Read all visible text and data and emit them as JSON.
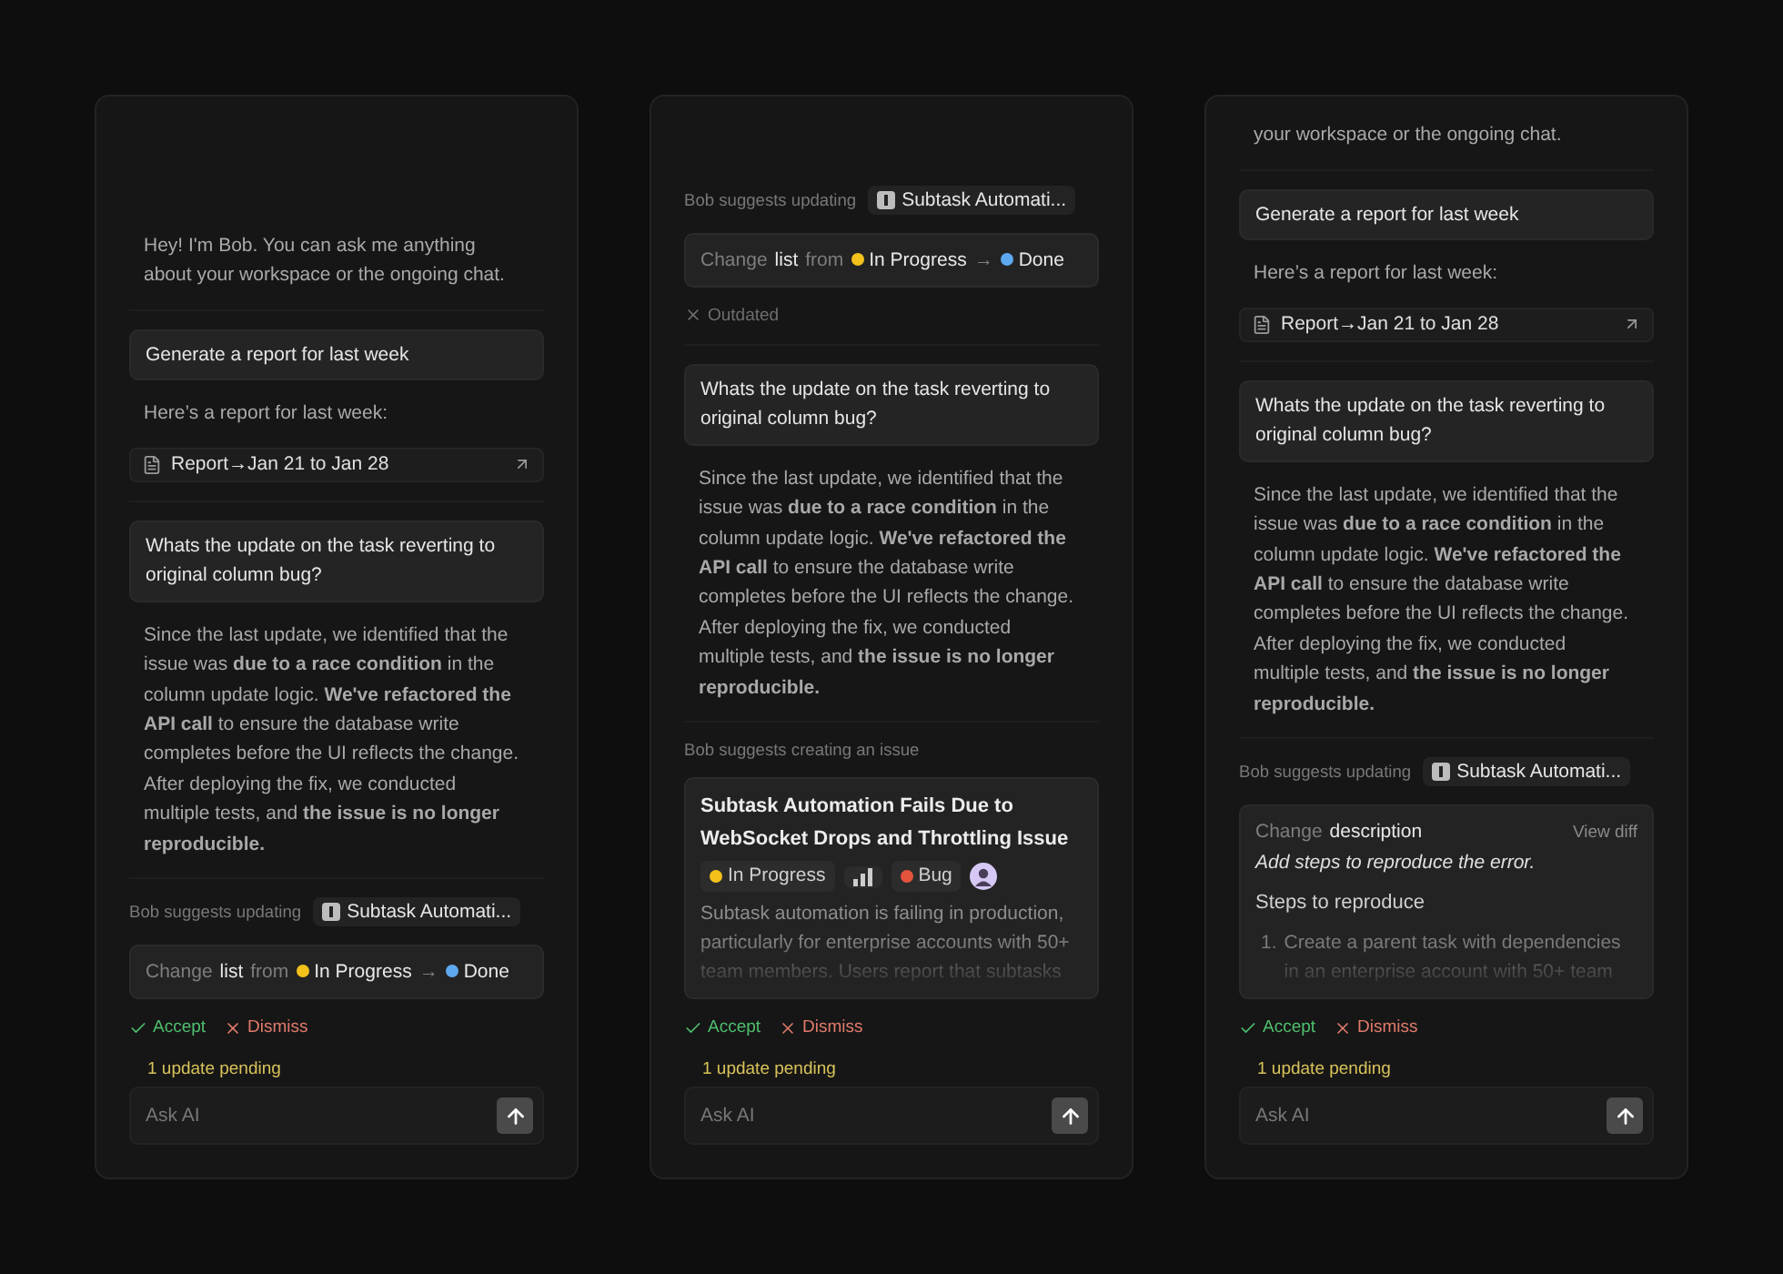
{
  "panels": [
    {
      "messages": [
        {
          "kind": "bot_text",
          "text": "Hey! I'm Bob. You can ask me anything about your workspace or the ongoing chat."
        },
        {
          "kind": "divider"
        },
        {
          "kind": "user",
          "text": "Generate a report for last week"
        },
        {
          "kind": "bot_text",
          "text": "Here’s a report for last week:"
        },
        {
          "kind": "report",
          "text": "Report→Jan 21 to Jan 28"
        },
        {
          "kind": "divider"
        },
        {
          "kind": "user",
          "text": "Whats the update on the task reverting to original column bug?"
        },
        {
          "kind": "bot_text",
          "text": "Since the last update, we identified that the issue was **due to a race condition** in the column update logic. **We've refactored the API call** to ensure the database write completes before the UI reflects the change. After deploying the fix, we conducted multiple tests, and **the issue is no longer reproducible.**"
        },
        {
          "kind": "divider"
        },
        {
          "kind": "suggestion",
          "intro": "Bob suggests updating",
          "target": "Subtask Automati...",
          "change": {
            "kind": "move",
            "verb": "Change",
            "field": "list",
            "from_word": "from",
            "from": {
              "label": "In Progress",
              "color": "#f2c21b"
            },
            "arrow": "→",
            "to": {
              "label": "Done",
              "color": "#5ea8ef"
            }
          },
          "outdated": false,
          "accept": "Accept",
          "dismiss": "Dismiss"
        }
      ],
      "pending": "1 update pending",
      "composer": {
        "placeholder": "Ask AI"
      }
    },
    {
      "messages": [
        {
          "kind": "suggestion",
          "intro": "Bob suggests updating",
          "target": "Subtask Automati...",
          "change": {
            "kind": "move",
            "verb": "Change",
            "field": "list",
            "from_word": "from",
            "from": {
              "label": "In Progress",
              "color": "#f2c21b"
            },
            "arrow": "→",
            "to": {
              "label": "Done",
              "color": "#5ea8ef"
            }
          },
          "outdated": true,
          "outdated_label": "Outdated"
        },
        {
          "kind": "divider"
        },
        {
          "kind": "user",
          "text": "Whats the update on the task reverting to original column bug?"
        },
        {
          "kind": "bot_text",
          "text": "Since the last update, we identified that the issue was **due to a race condition** in the column update logic. **We've refactored the API call** to ensure the database write completes before the UI reflects the change. After deploying the fix, we conducted multiple tests, and **the issue is no longer reproducible.**"
        },
        {
          "kind": "divider"
        },
        {
          "kind": "suggestion",
          "intro": "Bob suggests creating an issue",
          "change": {
            "kind": "issue",
            "title": "Subtask Automation Fails Due to WebSocket Drops and Throttling Issue",
            "tags": [
              {
                "kind": "status",
                "label": "In Progress",
                "color": "#f2c21b"
              },
              {
                "kind": "priority"
              },
              {
                "kind": "label",
                "label": "Bug",
                "color": "#e5533d"
              },
              {
                "kind": "avatar"
              }
            ],
            "body": "Subtask automation is failing in production, particularly for enterprise accounts with 50+ team members. Users report that subtasks"
          },
          "outdated": false,
          "accept": "Accept",
          "dismiss": "Dismiss"
        }
      ],
      "pending": "1 update pending",
      "composer": {
        "placeholder": "Ask AI"
      }
    },
    {
      "messages": [
        {
          "kind": "bot_text",
          "text": "your workspace or the ongoing chat."
        },
        {
          "kind": "divider"
        },
        {
          "kind": "user",
          "text": "Generate a report for last week"
        },
        {
          "kind": "bot_text",
          "text": "Here’s a report for last week:"
        },
        {
          "kind": "report",
          "text": "Report→Jan 21 to Jan 28"
        },
        {
          "kind": "divider"
        },
        {
          "kind": "user",
          "text": "Whats the update on the task reverting to original column bug?"
        },
        {
          "kind": "bot_text",
          "text": "Since the last update, we identified that the issue was **due to a race condition** in the column update logic. **We've refactored the API call** to ensure the database write completes before the UI reflects the change. After deploying the fix, we conducted multiple tests, and **the issue is no longer reproducible.**"
        },
        {
          "kind": "divider"
        },
        {
          "kind": "suggestion",
          "intro": "Bob suggests updating",
          "target": "Subtask Automati...",
          "change": {
            "kind": "description",
            "verb": "Change",
            "field": "description",
            "link": "View diff",
            "summary": "Add steps to reproduce the error.",
            "heading": "Steps to reproduce",
            "steps": [
              {
                "number": "1.",
                "text": "Create a parent task with dependencies in an enterprise account with 50+ team"
              }
            ]
          },
          "outdated": false,
          "accept": "Accept",
          "dismiss": "Dismiss"
        }
      ],
      "pending": "1 update pending",
      "composer": {
        "placeholder": "Ask AI"
      }
    }
  ]
}
